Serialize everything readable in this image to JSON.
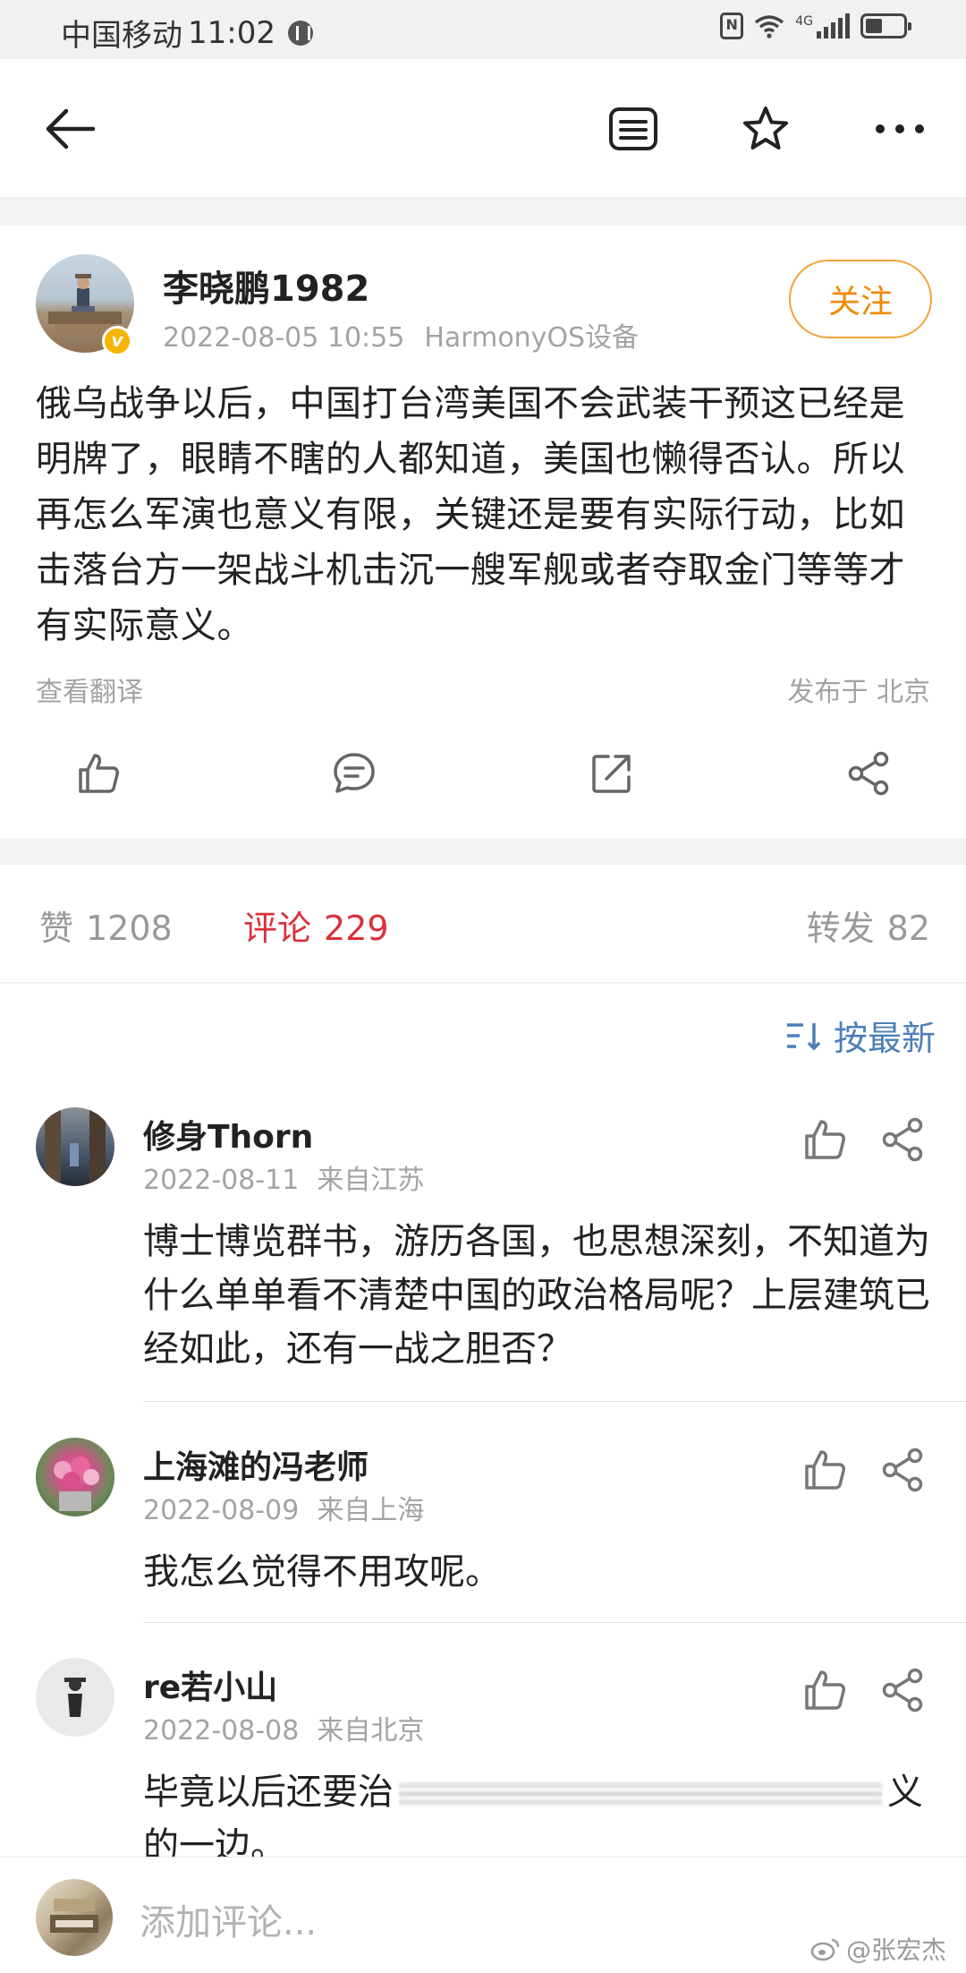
{
  "status_bar": {
    "carrier": "中国移动",
    "time": "11:02",
    "network": "4G"
  },
  "post": {
    "author": "李晓鹏1982",
    "date": "2022-08-05 10:55",
    "device": "HarmonyOS设备",
    "follow_label": "关注",
    "text": "俄乌战争以后，中国打台湾美国不会武装干预这已经是明牌了，眼睛不瞎的人都知道，美国也懒得否认。所以再怎么军演也意义有限，关键还是要有实际行动，比如击落台方一架战斗机击沉一艘军舰或者夺取金门等等才有实际意义。",
    "translate_label": "查看翻译",
    "location": "发布于 北京"
  },
  "stats": {
    "likes_label": "赞",
    "likes_count": "1208",
    "comments_label": "评论",
    "comments_count": "229",
    "reposts_label": "转发",
    "reposts_count": "82"
  },
  "sort": {
    "label": "按最新"
  },
  "comments": [
    {
      "name": "修身Thorn",
      "date": "2022-08-11",
      "source": "来自江苏",
      "text": "博士博览群书，游历各国，也思想深刻，不知道为什么单单看不清楚中国的政治格局呢？上层建筑已经如此，还有一战之胆否？"
    },
    {
      "name": "上海滩的冯老师",
      "date": "2022-08-09",
      "source": "来自上海",
      "text": "我怎么觉得不用攻呢。"
    },
    {
      "name": "re若小山",
      "date": "2022-08-08",
      "source": "来自北京",
      "text_start": "毕竟以后还要治",
      "text_end": "义",
      "text_line2": "的一边。"
    }
  ],
  "bottom": {
    "placeholder": "添加评论...",
    "watermark": "@张宏杰"
  },
  "colors": {
    "accent_orange": "#f08a00",
    "comment_red": "#d9303a",
    "link_blue": "#4b7fb8"
  }
}
